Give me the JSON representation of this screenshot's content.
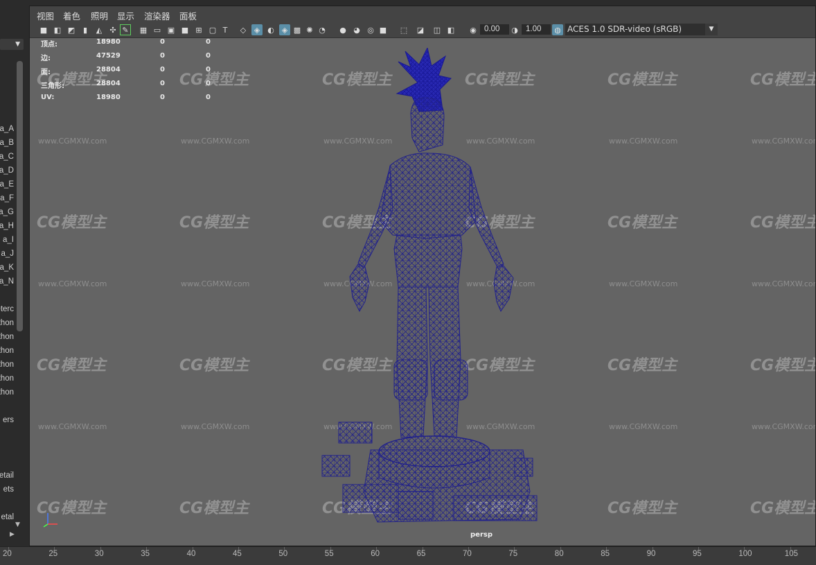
{
  "menu": [
    "视图",
    "着色",
    "照明",
    "显示",
    "渲染器",
    "面板"
  ],
  "toolbar": {
    "value_a": "0.00",
    "value_b": "1.00",
    "color_space": "ACES 1.0 SDR-video (sRGB)"
  },
  "outliner": {
    "items": [
      "a_A",
      "a_B",
      "a_C",
      "a_D",
      "a_E",
      "a_F",
      "a_G",
      "a_H",
      "a_I",
      "a_J",
      "eta_K",
      "eta_N",
      "eterc",
      "thon",
      "thon",
      "thon",
      "thon",
      "thon",
      "thon",
      "ers",
      "etail",
      "ets",
      "etal"
    ]
  },
  "stats": [
    {
      "label": "顶点:",
      "v1": "18980",
      "v2": "0",
      "v3": "0"
    },
    {
      "label": "边:",
      "v1": "47529",
      "v2": "0",
      "v3": "0"
    },
    {
      "label": "面:",
      "v1": "28804",
      "v2": "0",
      "v3": "0"
    },
    {
      "label": "三角形:",
      "v1": "28804",
      "v2": "0",
      "v3": "0"
    },
    {
      "label": "UV:",
      "v1": "18980",
      "v2": "0",
      "v3": "0"
    }
  ],
  "watermark": {
    "logo": "CG模型主",
    "url": "www.CGMXW.com"
  },
  "camera_label": "persp",
  "timeline_ticks": [
    "20",
    "25",
    "30",
    "35",
    "40",
    "45",
    "50",
    "55",
    "60",
    "65",
    "70",
    "75",
    "80",
    "85",
    "90",
    "95",
    "100",
    "105"
  ],
  "colors": {
    "viewport_bg": "#646464",
    "wire": "#22228a",
    "highlight": "#5b8fa8"
  }
}
